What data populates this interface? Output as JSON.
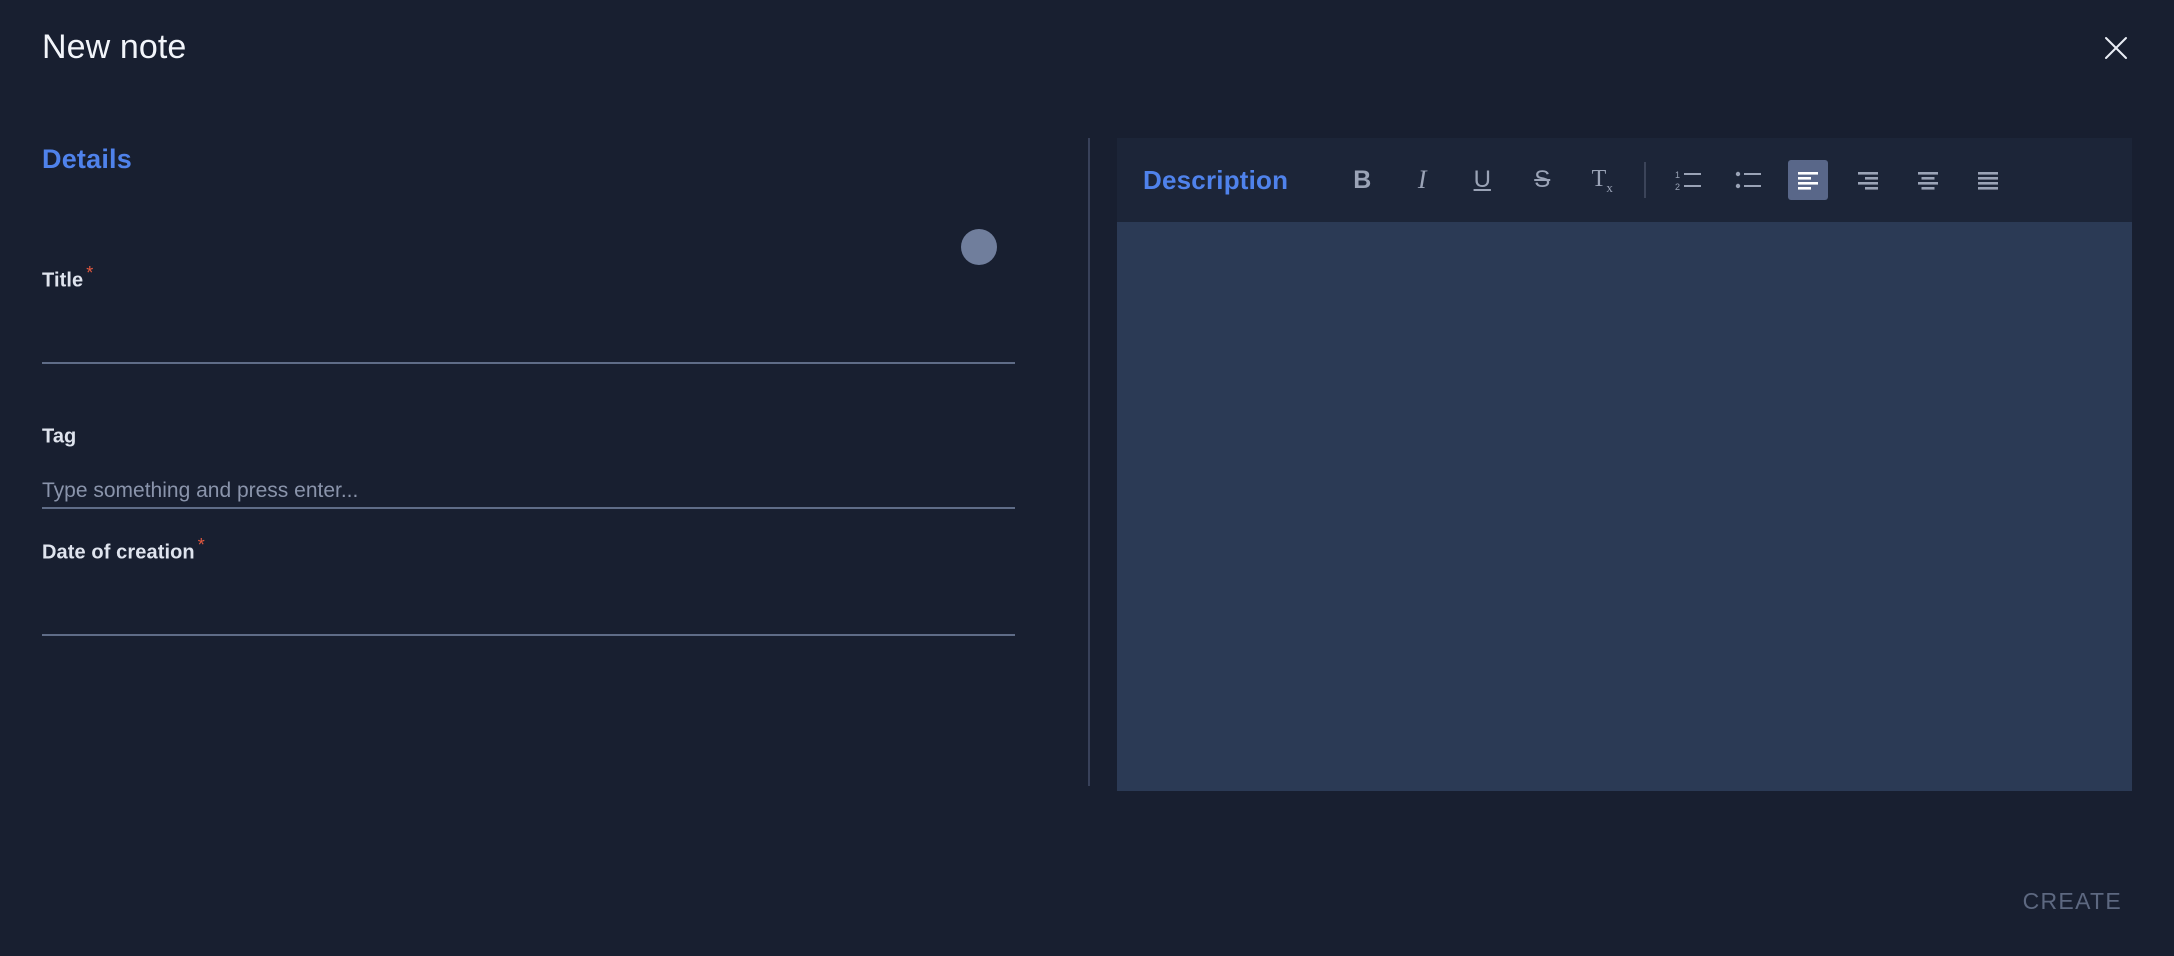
{
  "dialog": {
    "title": "New note",
    "close_icon": "close-icon"
  },
  "details": {
    "heading": "Details",
    "avatar_icon": "avatar-circle",
    "fields": [
      {
        "label": "Title",
        "required": true,
        "required_marker": "*",
        "value": "",
        "placeholder": ""
      },
      {
        "label": "Tag",
        "required": false,
        "required_marker": "",
        "value": "",
        "placeholder": "Type something and press enter..."
      },
      {
        "label": "Date of creation",
        "required": true,
        "required_marker": "*",
        "value": "",
        "placeholder": ""
      }
    ]
  },
  "editor": {
    "label": "Description",
    "content": "",
    "tools": [
      {
        "name": "bold-icon",
        "glyph": "B",
        "active": false
      },
      {
        "name": "italic-icon",
        "glyph": "I",
        "active": false
      },
      {
        "name": "underline-icon",
        "glyph": "U",
        "active": false
      },
      {
        "name": "strikethrough-icon",
        "glyph": "S",
        "active": false
      },
      {
        "name": "clear-format-icon",
        "glyph": "Tx",
        "active": false
      },
      {
        "name": "numbered-list-icon",
        "glyph": "",
        "active": false
      },
      {
        "name": "bullet-list-icon",
        "glyph": "",
        "active": false
      },
      {
        "name": "align-left-icon",
        "glyph": "",
        "active": true
      },
      {
        "name": "align-right-icon",
        "glyph": "",
        "active": false
      },
      {
        "name": "align-center-icon",
        "glyph": "",
        "active": false
      },
      {
        "name": "align-justify-icon",
        "glyph": "",
        "active": false
      }
    ]
  },
  "footer": {
    "create_label": "CREATE",
    "create_disabled": true
  },
  "colors": {
    "background": "#181f30",
    "accent_blue": "#4f82eb",
    "required_red": "#e4593f",
    "editor_body": "#2b3a55",
    "editor_toolbar": "#1c2538",
    "active_tool": "#596789",
    "avatar": "#707e9c",
    "underline": "#5f6c87",
    "disabled_text": "#5d6880"
  }
}
